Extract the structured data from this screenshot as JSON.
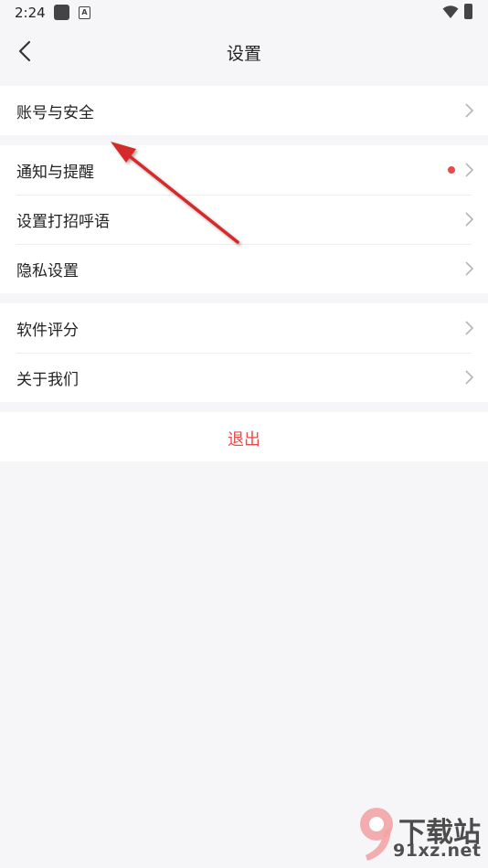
{
  "status_bar": {
    "time": "2:24",
    "icons": [
      "notification-square-icon",
      "a-badge-icon",
      "wifi-icon",
      "battery-charging-icon"
    ]
  },
  "nav": {
    "title": "设置",
    "back_icon": "chevron-left-icon"
  },
  "groups": [
    {
      "items": [
        {
          "label": "账号与安全",
          "badge": false
        }
      ]
    },
    {
      "items": [
        {
          "label": "通知与提醒",
          "badge": true
        },
        {
          "label": "设置打招呼语",
          "badge": false
        },
        {
          "label": "隐私设置",
          "badge": false
        }
      ]
    },
    {
      "items": [
        {
          "label": "软件评分",
          "badge": false
        },
        {
          "label": "关于我们",
          "badge": false
        }
      ]
    }
  ],
  "logout": {
    "label": "退出"
  },
  "watermark": {
    "line1": "下载站",
    "line2": "91xz.net",
    "logo_glyph": "9"
  },
  "colors": {
    "accent_red": "#e94a4a",
    "background": "#f6f6f8",
    "card": "#ffffff",
    "annotation_arrow": "#d42a2a"
  }
}
